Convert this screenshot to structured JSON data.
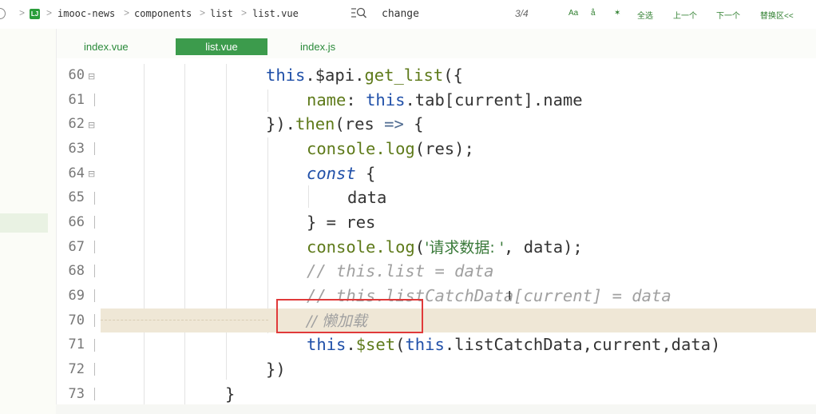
{
  "breadcrumb": [
    "imooc-news",
    "components",
    "list",
    "list.vue"
  ],
  "project_icon_label": "LJ",
  "search": {
    "value": "change",
    "match_count": "3/4"
  },
  "toolbar": {
    "match_case": "Aa",
    "regex": "å",
    "whole_word": "✶",
    "select_all": "全选",
    "prev": "上一个",
    "next": "下一个",
    "replace": "替换区<<"
  },
  "tabs": [
    {
      "label": "index.vue",
      "active": false
    },
    {
      "label": "list.vue",
      "active": true
    },
    {
      "label": "index.js",
      "active": false
    }
  ],
  "line_numbers": [
    "60",
    "61",
    "62",
    "63",
    "64",
    "65",
    "66",
    "67",
    "68",
    "69",
    "70",
    "71",
    "72",
    "73"
  ],
  "code": {
    "l60": {
      "kw1": "this",
      "a": ".$api.",
      "fn": "get_list",
      "b": "({"
    },
    "l61": {
      "prop": "name",
      "a": ": ",
      "kw": "this",
      "b": ".tab[current].name"
    },
    "l62": {
      "a": "}).",
      "fn": "then",
      "b": "(res ",
      "op": "=>",
      "c": " {"
    },
    "l63": {
      "a": "console.",
      "fn": "log",
      "b": "(res);"
    },
    "l64": {
      "kw": "const",
      "b": " {"
    },
    "l65": {
      "a": "data"
    },
    "l66": {
      "a": "} = res"
    },
    "l67": {
      "a": "console.",
      "fn": "log",
      "b": "(",
      "str": "'请求数据: '",
      "c": ", data);"
    },
    "l68": {
      "cmt": "// this.list = data"
    },
    "l69": {
      "cmt": "// this.listCatchData[current] = data"
    },
    "l70": {
      "cmt": "// 懒加载"
    },
    "l71": {
      "kw1": "this",
      "a": ".",
      "fn": "$set",
      "b": "(",
      "kw2": "this",
      "c": ".listCatchData,current,data)"
    },
    "l72": {
      "a": "})"
    },
    "l73": {
      "a": "}"
    }
  },
  "colors": {
    "accent_green": "#3c9b4c",
    "highlight_row": "#efe7d6",
    "annotation_red": "#e03a3a"
  }
}
